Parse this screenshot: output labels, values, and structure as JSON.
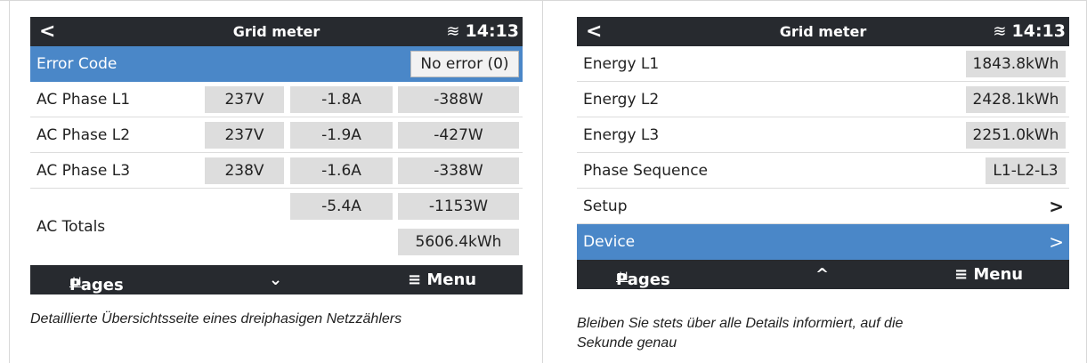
{
  "left": {
    "status": {
      "back": "<",
      "title": "Grid meter",
      "wifi": "◔",
      "time": "14:13"
    },
    "error_row": {
      "label": "Error Code",
      "value": "No error (0)"
    },
    "phases": [
      {
        "label": "AC Phase L1",
        "v": "237V",
        "a": "-1.8A",
        "w": "-388W"
      },
      {
        "label": "AC Phase L2",
        "v": "237V",
        "a": "-1.9A",
        "w": "-427W"
      },
      {
        "label": "AC Phase L3",
        "v": "238V",
        "a": "-1.6A",
        "w": "-338W"
      }
    ],
    "totals": {
      "label": "AC Totals",
      "a": "-5.4A",
      "w": "-1153W",
      "kwh": "5606.4kWh"
    },
    "footer": {
      "pages": "Pages",
      "center": "⌄",
      "menu": "≡ Menu"
    },
    "caption": "Detaillierte Übersichtsseite eines dreiphasigen Netzzählers"
  },
  "right": {
    "status": {
      "back": "<",
      "title": "Grid meter",
      "wifi": "◔",
      "time": "14:13"
    },
    "rows": [
      {
        "label": "Energy L1",
        "value": "1843.8kWh"
      },
      {
        "label": "Energy L2",
        "value": "2428.1kWh"
      },
      {
        "label": "Energy L3",
        "value": "2251.0kWh"
      },
      {
        "label": "Phase Sequence",
        "value": "L1-L2-L3"
      }
    ],
    "setup": {
      "label": "Setup",
      "chev": ">"
    },
    "device": {
      "label": "Device",
      "chev": ">"
    },
    "footer": {
      "pages": "Pages",
      "center": "^",
      "menu": "≡ Menu"
    },
    "caption_line1": "Bleiben Sie stets über alle Details informiert, auf die",
    "caption_line2": "Sekunde genau"
  },
  "colors": {
    "header": "#272a2f",
    "highlight": "#4a87c8",
    "value_box": "#dddddd"
  },
  "icons": {
    "wifi": "wifi-icon",
    "pages": "bar-chart-icon",
    "menu": "hamburger-menu-icon"
  }
}
